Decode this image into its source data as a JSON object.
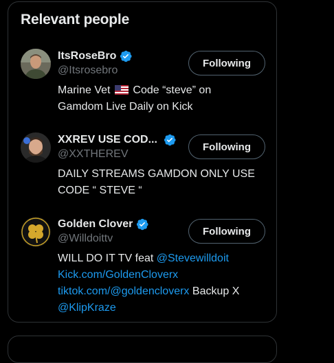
{
  "section": {
    "title": "Relevant people"
  },
  "people": [
    {
      "name": "ItsRoseBro",
      "handle": "@Itsrosebro",
      "button": "Following",
      "bio": {
        "before_flag": "Marine Vet",
        "flag_icon": "us-flag-icon",
        "after_flag": "Code “steve” on",
        "line2": "Gamdom Live Daily on Kick"
      }
    },
    {
      "name": "XXREV USE COD...",
      "handle": "@XXTHEREV",
      "button": "Following",
      "bio": {
        "line1": "DAILY STREAMS GAMDON ONLY USE",
        "line2": "CODE “ STEVE “"
      }
    },
    {
      "name": "Golden Clover",
      "handle": "@Willdoittv",
      "button": "Following",
      "bio": {
        "text1": "WILL DO IT TV feat",
        "mention1": "@Stevewilldoit",
        "link1": "Kick.com/GoldenCloverx",
        "link2": "tiktok.com/@goldencloverx",
        "text2": "Backup X",
        "mention2": "@KlipKraze"
      }
    }
  ],
  "colors": {
    "background": "#000000",
    "border": "#2f3336",
    "text": "#e7e9ea",
    "muted": "#71767b",
    "link": "#1d9bf0",
    "verified": "#1d9bf0"
  }
}
